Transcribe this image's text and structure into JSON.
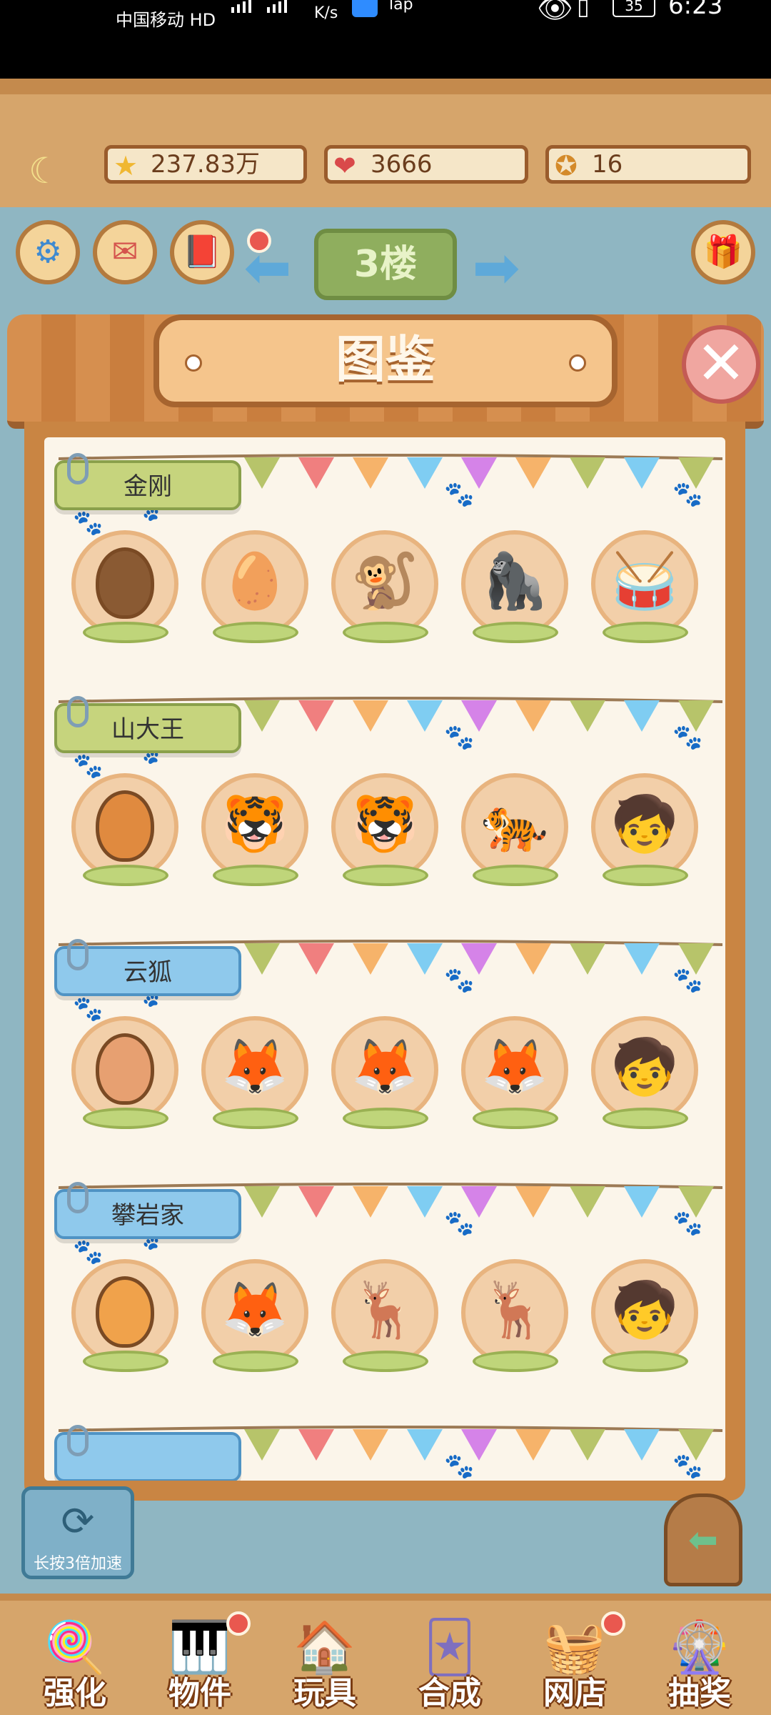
{
  "status_bar": {
    "carrier": "中国移动 HD",
    "network_rate": "K/s",
    "app_label": "lap",
    "battery": "35",
    "time": "6:23"
  },
  "resources": [
    {
      "icon": "star-icon",
      "glyph": "★",
      "value": "237.83万"
    },
    {
      "icon": "heart-icon",
      "glyph": "❤",
      "value": "3666"
    },
    {
      "icon": "paw-coin-icon",
      "glyph": "✪",
      "value": "16"
    }
  ],
  "floor": {
    "label": "3楼"
  },
  "modal": {
    "title": "图鉴",
    "close_glyph": "✕",
    "rows": [
      {
        "name": "金刚",
        "color": "green",
        "stages": [
          "🐵",
          "🥚",
          "🐒",
          "🦍",
          "🥁"
        ]
      },
      {
        "name": "山大王",
        "color": "green",
        "stages": [
          "🥚",
          "🐯",
          "🐯",
          "🐅",
          "🧒"
        ]
      },
      {
        "name": "云狐",
        "color": "blue",
        "stages": [
          "🥚",
          "🦊",
          "🦊",
          "🦊",
          "🧒"
        ]
      },
      {
        "name": "攀岩家",
        "color": "blue",
        "stages": [
          "🥚",
          "🦊",
          "🦌",
          "🦌",
          "🧒"
        ]
      },
      {
        "name": "",
        "color": "blue",
        "stages": []
      }
    ]
  },
  "speedup": {
    "label": "长按3倍加速",
    "glyph": "⟳"
  },
  "door": {
    "glyph": "⬅"
  },
  "bottom_nav": [
    {
      "label": "强化",
      "icon": "swirl-icon",
      "glyph": "🍭",
      "badge": false
    },
    {
      "label": "物件",
      "icon": "piano-icon",
      "glyph": "🎹",
      "badge": true
    },
    {
      "label": "玩具",
      "icon": "house-toy-icon",
      "glyph": "🏠",
      "badge": false
    },
    {
      "label": "合成",
      "icon": "cards-icon",
      "glyph": "🃏",
      "badge": false
    },
    {
      "label": "网店",
      "icon": "basket-icon",
      "glyph": "🧺",
      "badge": true
    },
    {
      "label": "抽奖",
      "icon": "wheel-icon",
      "glyph": "🎡",
      "badge": false
    }
  ]
}
